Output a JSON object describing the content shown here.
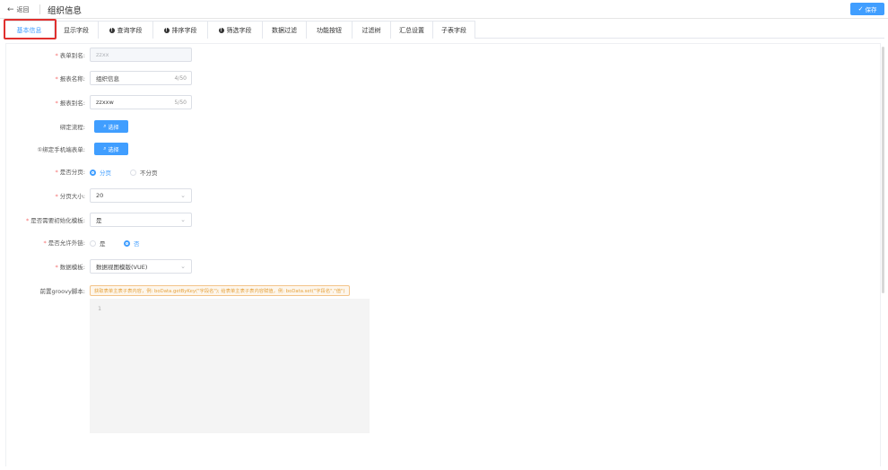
{
  "header": {
    "back_label": "返回",
    "title": "组织信息",
    "save_label": "保存"
  },
  "tabs": [
    {
      "label": "基本信息",
      "active": true,
      "info_icon": false
    },
    {
      "label": "显示字段",
      "active": false,
      "info_icon": false
    },
    {
      "label": "查询字段",
      "active": false,
      "info_icon": true
    },
    {
      "label": "排序字段",
      "active": false,
      "info_icon": true
    },
    {
      "label": "筛选字段",
      "active": false,
      "info_icon": true
    },
    {
      "label": "数据过滤",
      "active": false,
      "info_icon": false
    },
    {
      "label": "功能按钮",
      "active": false,
      "info_icon": false
    },
    {
      "label": "过滤树",
      "active": false,
      "info_icon": false
    },
    {
      "label": "汇总设置",
      "active": false,
      "info_icon": false
    },
    {
      "label": "子表字段",
      "active": false,
      "info_icon": false
    }
  ],
  "form": {
    "table_alias": {
      "label": "表单别名:",
      "value": "zzxx",
      "required": true
    },
    "report_name": {
      "label": "报表名称:",
      "value": "组织信息",
      "count": "4/50",
      "required": true
    },
    "report_alias": {
      "label": "报表别名:",
      "value": "zzxxw",
      "count": "5/50",
      "required": true
    },
    "bind_flow": {
      "label": "绑定流程:",
      "button": "选择"
    },
    "bind_mobile": {
      "label": "①绑定手机端表单:",
      "button": "选择"
    },
    "paging": {
      "label": "是否分页:",
      "required": true,
      "options": [
        "分页",
        "不分页"
      ],
      "selected": "分页"
    },
    "page_size": {
      "label": "分页大小:",
      "value": "20",
      "required": true
    },
    "init_template": {
      "label": "是否需要初始化模板:",
      "value": "是",
      "required": true
    },
    "allow_external": {
      "label": "是否允许外链:",
      "required": true,
      "options": [
        "是",
        "否"
      ],
      "selected": "否"
    },
    "data_template": {
      "label": "数据模板:",
      "value": "数据视图模版(VUE)",
      "required": true
    },
    "groovy": {
      "label": "前置groovy脚本:",
      "hint": "获取表单主表子表内容，例: boData.getByKey(\"字段名\"); 给表单主表子表内容赋值，例: boData.set(\"字段名\",\"值\")",
      "line_number": "1"
    }
  },
  "colors": {
    "accent": "#409eff",
    "required": "#f56c6c",
    "highlight_box": "#e0302e",
    "hint_text": "#e6a23c"
  }
}
